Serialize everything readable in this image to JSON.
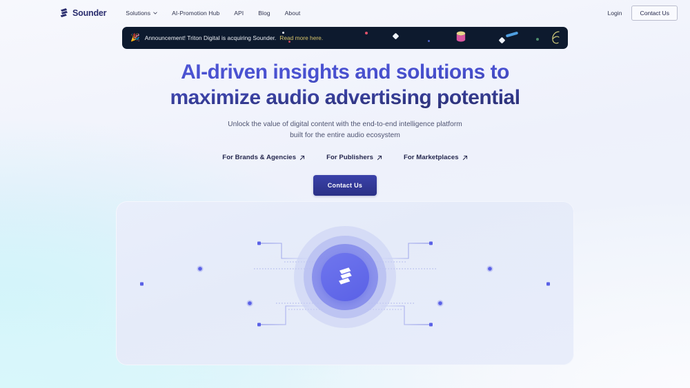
{
  "brand": {
    "name": "Sounder",
    "logo_icon": "sounder-logo-icon",
    "mark_color": "#2a2d6e"
  },
  "nav": {
    "items": [
      {
        "label": "Solutions",
        "has_dropdown": true,
        "icon": "chevron-down-icon"
      },
      {
        "label": "AI-Promotion Hub",
        "has_dropdown": false
      },
      {
        "label": "API",
        "has_dropdown": false
      },
      {
        "label": "Blog",
        "has_dropdown": false
      },
      {
        "label": "About",
        "has_dropdown": false
      }
    ],
    "login_label": "Login",
    "contact_label": "Contact Us"
  },
  "banner": {
    "emoji": "🎉",
    "emoji_name": "party-popper-icon",
    "text": "Announcement! Triton Digital is acquiring Sounder.",
    "link_label": "Read more here.",
    "background": "#0d1a2e",
    "link_color": "#d9c66a"
  },
  "hero": {
    "headline_line1": "AI-driven insights and solutions to",
    "headline_line2": "maximize audio advertising potential",
    "subhead_line1": "Unlock the value of digital content with the end-to-end intelligence platform",
    "subhead_line2": "built for the entire audio ecosystem",
    "headline_gradient_from": "#5158d8",
    "headline_gradient_to": "#262c6e",
    "audience_links": [
      {
        "label": "For Brands & Agencies",
        "icon": "arrow-up-right-icon"
      },
      {
        "label": "For Publishers",
        "icon": "arrow-up-right-icon"
      },
      {
        "label": "For Marketplaces",
        "icon": "arrow-up-right-icon"
      }
    ],
    "cta_label": "Contact Us",
    "cta_color": "#2f3596"
  },
  "visual": {
    "center_logo_icon": "sounder-logo-mark-icon",
    "orb_color": "#5a61e6",
    "card_background": "#e7ecfa"
  }
}
